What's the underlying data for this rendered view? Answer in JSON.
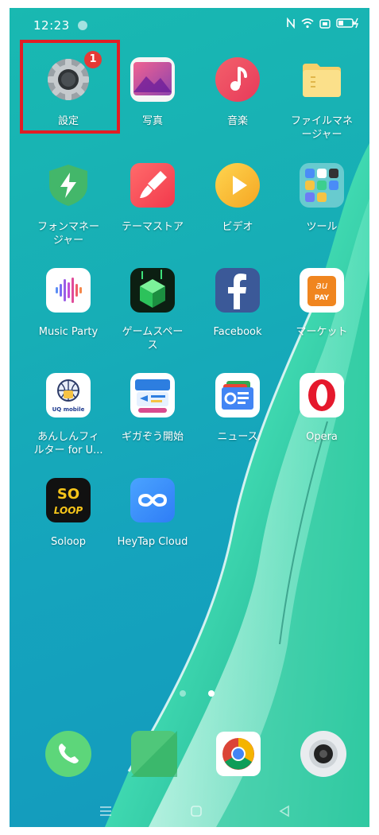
{
  "status_bar": {
    "time": "12:23",
    "icons": [
      "nfc-icon",
      "wifi-icon",
      "sim-icon",
      "battery-charging-icon"
    ]
  },
  "apps": [
    {
      "id": "settings",
      "label": "設定",
      "icon": "settings-icon",
      "badge": "1",
      "highlighted": true
    },
    {
      "id": "photos",
      "label": "写真",
      "icon": "photos-icon"
    },
    {
      "id": "music",
      "label": "音楽",
      "icon": "music-icon"
    },
    {
      "id": "file-manager",
      "label": "ファイルマネ\nージャー",
      "icon": "folder-icon"
    },
    {
      "id": "phone-manager",
      "label": "フォンマネー\nジャー",
      "icon": "shield-bolt-icon"
    },
    {
      "id": "theme-store",
      "label": "テーマストア",
      "icon": "brush-icon"
    },
    {
      "id": "video",
      "label": "ビデオ",
      "icon": "play-icon"
    },
    {
      "id": "tools",
      "label": "ツール",
      "icon": "folder-grid-icon"
    },
    {
      "id": "music-party",
      "label": "Music Party",
      "icon": "sound-bars-icon"
    },
    {
      "id": "game-space",
      "label": "ゲームスペー\nス",
      "icon": "cube-icon"
    },
    {
      "id": "facebook",
      "label": "Facebook",
      "icon": "facebook-icon"
    },
    {
      "id": "market",
      "label": "マーケット",
      "icon": "au-pay-icon"
    },
    {
      "id": "anshin-filter",
      "label": "あんしんフィ\nルター for U...",
      "icon": "uq-mobile-icon"
    },
    {
      "id": "giga-hajime",
      "label": "ギガぞう開始",
      "icon": "gigazo-icon"
    },
    {
      "id": "news",
      "label": "ニュース",
      "icon": "google-news-icon"
    },
    {
      "id": "opera",
      "label": "Opera",
      "icon": "opera-icon"
    },
    {
      "id": "soloop",
      "label": "Soloop",
      "icon": "soloop-icon"
    },
    {
      "id": "heytap-cloud",
      "label": "HeyTap Cloud",
      "icon": "cloud-infinity-icon"
    }
  ],
  "icon_text": {
    "soloop_top": "SO",
    "soloop_bottom": "LOOP",
    "aupay_top": "au",
    "aupay_bottom": "PAY",
    "uq": "UQ mobile"
  },
  "page_indicator": {
    "count": 2,
    "active": 2
  },
  "dock": [
    {
      "id": "phone",
      "icon": "phone-icon"
    },
    {
      "id": "messages",
      "icon": "messages-icon"
    },
    {
      "id": "chrome",
      "icon": "chrome-icon"
    },
    {
      "id": "camera",
      "icon": "camera-icon"
    }
  ],
  "nav_bar": [
    "menu-icon",
    "home-icon",
    "back-icon"
  ],
  "colors": {
    "highlight_border": "#e11d24",
    "badge": "#e53935"
  }
}
